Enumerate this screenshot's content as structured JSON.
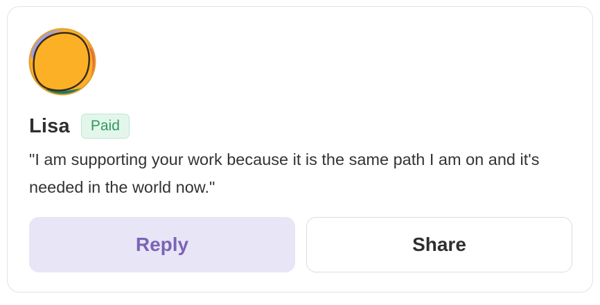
{
  "comment": {
    "author_name": "Lisa",
    "badge_label": "Paid",
    "text": "\"I am supporting your work because it is the same path I am on and it's needed in the world now.\"",
    "avatar_icon": "colorful-circle-avatar"
  },
  "actions": {
    "reply_label": "Reply",
    "share_label": "Share"
  },
  "colors": {
    "badge_text": "#2e9a5c",
    "badge_bg": "#e4f6ec",
    "reply_bg": "#e8e5f7",
    "reply_text": "#7b63b6",
    "avatar_yellow": "#fbb026",
    "avatar_green": "#1f7a5c",
    "avatar_orange": "#ef6a3a",
    "avatar_lavender": "#9fa0e0"
  }
}
